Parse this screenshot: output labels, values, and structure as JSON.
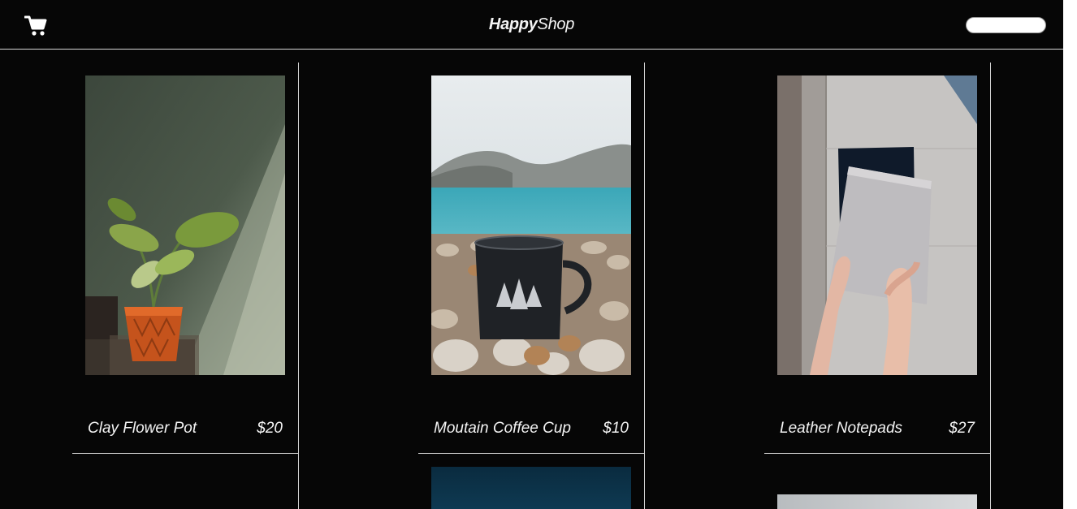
{
  "header": {
    "cart_icon": "cart-icon",
    "brand_bold": "Happy",
    "brand_light": "Shop",
    "search_value": "",
    "search_placeholder": ""
  },
  "products": [
    {
      "name": "Clay Flower Pot",
      "price": "$20",
      "image": "potted-plant-photo"
    },
    {
      "name": "Moutain Coffee Cup",
      "price": "$10",
      "image": "mug-on-beach-photo"
    },
    {
      "name": "Leather Notepads",
      "price": "$27",
      "image": "hands-holding-notepads-photo"
    }
  ],
  "colors": {
    "background": "#060606",
    "text": "#f4f4f4",
    "divider": "#cfcfcf"
  }
}
